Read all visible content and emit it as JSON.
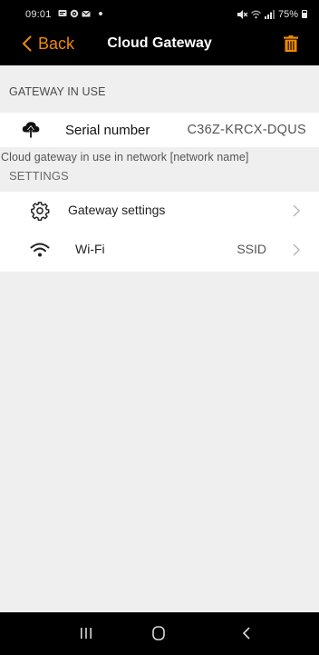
{
  "status_bar": {
    "time": "09:01",
    "battery": "75%"
  },
  "nav": {
    "back_label": "Back",
    "title": "Cloud Gateway"
  },
  "gateway_section": {
    "header": "GATEWAY IN USE",
    "serial_label": "Serial number",
    "serial_value": "C36Z-KRCX-DQUS",
    "info": "Cloud gateway in use in network [network name]"
  },
  "settings_section": {
    "header": "SETTINGS",
    "items": [
      {
        "label": "Gateway settings",
        "value": "",
        "icon": "gear-icon"
      },
      {
        "label": "Wi-Fi",
        "value": "SSID",
        "icon": "wifi-icon"
      }
    ]
  },
  "colors": {
    "accent": "#f08a00",
    "bar_bg": "#000000",
    "page_bg": "#efefef"
  }
}
